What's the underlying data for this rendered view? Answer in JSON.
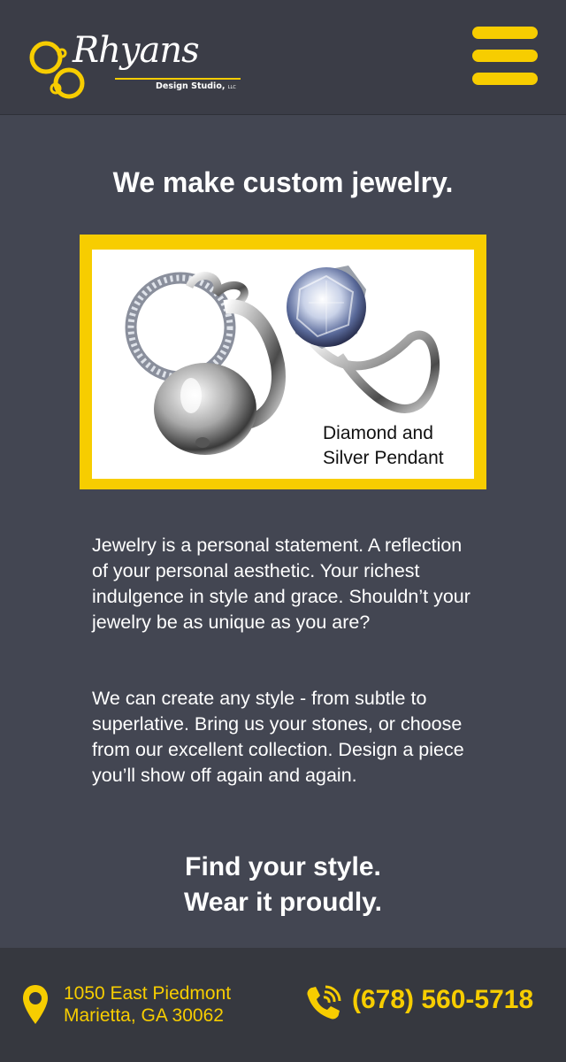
{
  "header": {
    "logo": {
      "brand": "Rhyans",
      "subtitle": "Design Studio,",
      "suffix": "LLC",
      "accent_color": "#f7cd00"
    },
    "menu_icon": "hamburger-menu-icon"
  },
  "main": {
    "headline": "We make custom jewelry.",
    "feature_image": {
      "caption": "Diamond and\nSilver Pendant",
      "frame_color": "#f7cd00"
    },
    "paragraphs": [
      "Jewelry is a personal statement. A reflection of your personal aesthetic. Your richest indulgence in style and grace. Shouldn’t your jewelry be as unique as you are?",
      "We can create any style - from subtle to superlative. Bring us your stones, or choose from our excellent collection. Design a piece you’ll show off again and again."
    ],
    "tagline": {
      "line1": "Find your style.",
      "line2": "Wear it proudly."
    }
  },
  "footer": {
    "address": {
      "line1": "1050 East Piedmont",
      "line2": "Marietta, GA 30062",
      "icon": "map-pin-icon"
    },
    "phone": {
      "number": "(678) 560-5718",
      "icon": "phone-icon"
    },
    "accent_color": "#f7cd00"
  },
  "colors": {
    "page_background": "#434652",
    "header_background": "#3b3d47",
    "footer_background": "#36383f",
    "accent": "#f7cd00",
    "text": "#ffffff"
  }
}
